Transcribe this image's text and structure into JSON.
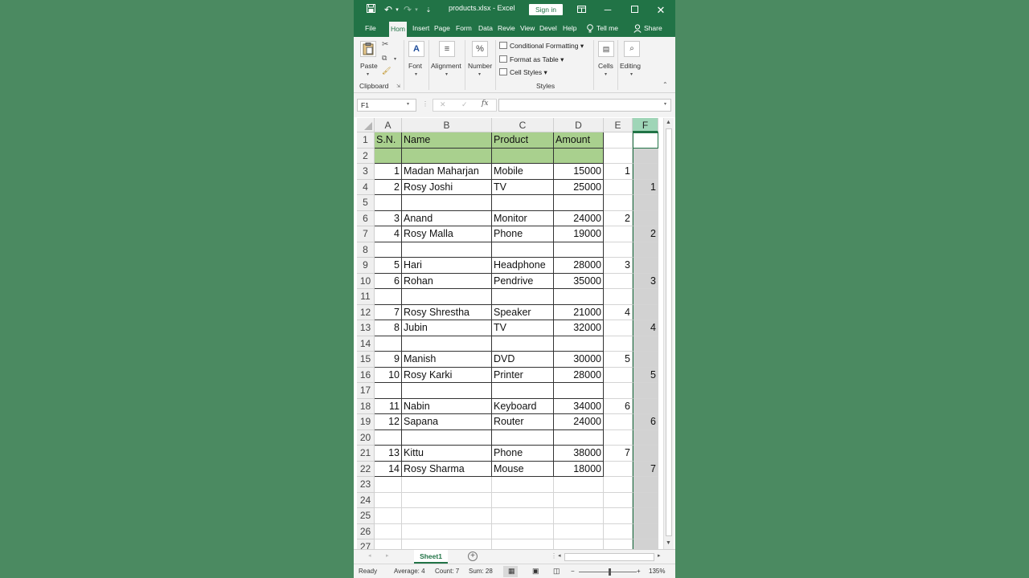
{
  "window": {
    "title": "products.xlsx  -  Excel",
    "signin_label": "Sign in"
  },
  "ribbon_tabs": [
    "File",
    "Hom",
    "Insert",
    "Page",
    "Form",
    "Data",
    "Revie",
    "View",
    "Devel",
    "Help",
    "Tell me",
    "Share"
  ],
  "ribbon": {
    "paste": "Paste",
    "clipboard": "Clipboard",
    "font": "Font",
    "alignment": "Alignment",
    "number": "Number",
    "number_icon": "%",
    "conditional_formatting": "Conditional Formatting",
    "format_as_table": "Format as Table",
    "cell_styles": "Cell Styles",
    "styles": "Styles",
    "cells": "Cells",
    "editing": "Editing"
  },
  "formula_bar": {
    "name_box": "F1",
    "fx": "fx",
    "value": ""
  },
  "columns": [
    "A",
    "B",
    "C",
    "D",
    "E",
    "F"
  ],
  "rows": [
    {
      "n": "1",
      "a": "S.N.",
      "b": "Name",
      "c": "Product",
      "d": "Amount",
      "e": "",
      "f": ""
    },
    {
      "n": "2",
      "a": "",
      "b": "",
      "c": "",
      "d": "",
      "e": "",
      "f": ""
    },
    {
      "n": "3",
      "a": "1",
      "b": "Madan Maharjan",
      "c": "Mobile",
      "d": "15000",
      "e": "1",
      "f": ""
    },
    {
      "n": "4",
      "a": "2",
      "b": "Rosy Joshi",
      "c": "TV",
      "d": "25000",
      "e": "",
      "f": "1"
    },
    {
      "n": "5",
      "a": "",
      "b": "",
      "c": "",
      "d": "",
      "e": "",
      "f": ""
    },
    {
      "n": "6",
      "a": "3",
      "b": "Anand",
      "c": "Monitor",
      "d": "24000",
      "e": "2",
      "f": ""
    },
    {
      "n": "7",
      "a": "4",
      "b": "Rosy Malla",
      "c": "Phone",
      "d": "19000",
      "e": "",
      "f": "2"
    },
    {
      "n": "8",
      "a": "",
      "b": "",
      "c": "",
      "d": "",
      "e": "",
      "f": ""
    },
    {
      "n": "9",
      "a": "5",
      "b": "Hari",
      "c": "Headphone",
      "d": "28000",
      "e": "3",
      "f": ""
    },
    {
      "n": "10",
      "a": "6",
      "b": "Rohan",
      "c": "Pendrive",
      "d": "35000",
      "e": "",
      "f": "3"
    },
    {
      "n": "11",
      "a": "",
      "b": "",
      "c": "",
      "d": "",
      "e": "",
      "f": ""
    },
    {
      "n": "12",
      "a": "7",
      "b": "Rosy Shrestha",
      "c": "Speaker",
      "d": "21000",
      "e": "4",
      "f": ""
    },
    {
      "n": "13",
      "a": "8",
      "b": "Jubin",
      "c": "TV",
      "d": "32000",
      "e": "",
      "f": "4"
    },
    {
      "n": "14",
      "a": "",
      "b": "",
      "c": "",
      "d": "",
      "e": "",
      "f": ""
    },
    {
      "n": "15",
      "a": "9",
      "b": "Manish",
      "c": "DVD",
      "d": "30000",
      "e": "5",
      "f": ""
    },
    {
      "n": "16",
      "a": "10",
      "b": "Rosy Karki",
      "c": "Printer",
      "d": "28000",
      "e": "",
      "f": "5"
    },
    {
      "n": "17",
      "a": "",
      "b": "",
      "c": "",
      "d": "",
      "e": "",
      "f": ""
    },
    {
      "n": "18",
      "a": "11",
      "b": "Nabin",
      "c": "Keyboard",
      "d": "34000",
      "e": "6",
      "f": ""
    },
    {
      "n": "19",
      "a": "12",
      "b": "Sapana",
      "c": "Router",
      "d": "24000",
      "e": "",
      "f": "6"
    },
    {
      "n": "20",
      "a": "",
      "b": "",
      "c": "",
      "d": "",
      "e": "",
      "f": ""
    },
    {
      "n": "21",
      "a": "13",
      "b": "Kittu",
      "c": "Phone",
      "d": "38000",
      "e": "7",
      "f": ""
    },
    {
      "n": "22",
      "a": "14",
      "b": "Rosy Sharma",
      "c": "Mouse",
      "d": "18000",
      "e": "",
      "f": "7"
    },
    {
      "n": "23",
      "a": "",
      "b": "",
      "c": "",
      "d": "",
      "e": "",
      "f": ""
    },
    {
      "n": "24",
      "a": "",
      "b": "",
      "c": "",
      "d": "",
      "e": "",
      "f": ""
    },
    {
      "n": "25",
      "a": "",
      "b": "",
      "c": "",
      "d": "",
      "e": "",
      "f": ""
    },
    {
      "n": "26",
      "a": "",
      "b": "",
      "c": "",
      "d": "",
      "e": "",
      "f": ""
    },
    {
      "n": "27",
      "a": "",
      "b": "",
      "c": "",
      "d": "",
      "e": "",
      "f": ""
    }
  ],
  "sheet_tab": "Sheet1",
  "status": {
    "ready": "Ready",
    "average": "Average: 4",
    "count": "Count: 7",
    "sum": "Sum: 28",
    "zoom": "135%"
  },
  "colors": {
    "excel_green": "#217346",
    "header_fill": "#a9d08e",
    "selection_gray": "#d2d2d2"
  }
}
